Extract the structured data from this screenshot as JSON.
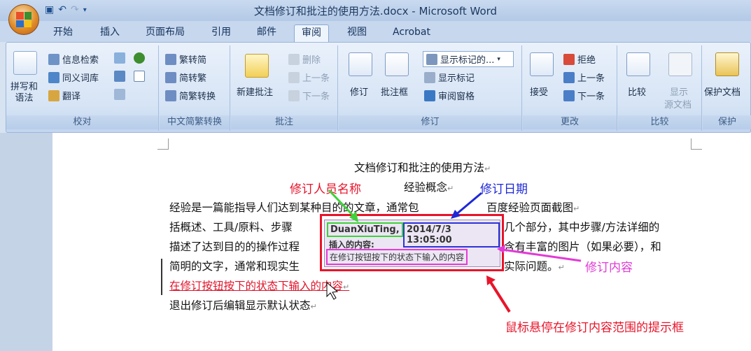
{
  "window": {
    "title": "文档修订和批注的使用方法.docx - Microsoft Word"
  },
  "tabs": [
    "开始",
    "插入",
    "页面布局",
    "引用",
    "邮件",
    "审阅",
    "视图",
    "Acrobat"
  ],
  "ribbon": {
    "proof": {
      "big": "拼写和\n语法",
      "research": "信息检索",
      "thesaurus": "同义词库",
      "translate": "翻译",
      "label": "校对"
    },
    "chinese": {
      "t2s": "繁转简",
      "s2t": "简转繁",
      "conv": "简繁转换",
      "label": "中文简繁转换"
    },
    "comments": {
      "new": "新建批注",
      "del": "删除",
      "prev": "上一条",
      "next": "下一条",
      "label": "批注"
    },
    "tracking": {
      "track": "修订",
      "balloons": "批注框",
      "display": "显示标记的...",
      "show_markup": "显示标记",
      "pane": "审阅窗格",
      "label": "修订"
    },
    "changes": {
      "accept": "接受",
      "reject": "拒绝",
      "prev": "上一条",
      "next": "下一条",
      "label": "更改"
    },
    "compare": {
      "compare": "比较",
      "show": "显示",
      "source": "源文档",
      "label": "比较"
    },
    "protect": {
      "protect": "保护文档",
      "label": "保护"
    }
  },
  "document": {
    "title": "文档修订和批注的使用方法",
    "subtitle": "经验概念",
    "p1a": "经验是一篇能指导人们达到某种目的的文章，通常包",
    "p1b": "百度经验页面截图",
    "p2a": "括概述、工具/原料、步骤",
    "p2b": "几个部分，其中步骤/方法详细的",
    "p3a": "描述了达到目的的操作过程",
    "p3b": "含有丰富的图片（如果必要），和",
    "p4a": "简明的文字，通常和现实生",
    "p4b": "实际问题。",
    "inserted": "在修订按钮按下的状态下输入的内容",
    "last": "退出修订后编辑显示默认状态"
  },
  "tooltip": {
    "author": "DuanXiuTing,",
    "date": "2014/7/3 13:05:00",
    "type": "插入的内容:",
    "content": "在修订按钮按下的状态下输入的内容"
  },
  "annotations": {
    "author": "修订人员名称",
    "date": "修订日期",
    "content": "修订内容",
    "hover": "鼠标悬停在修订内容范围的提示框"
  }
}
